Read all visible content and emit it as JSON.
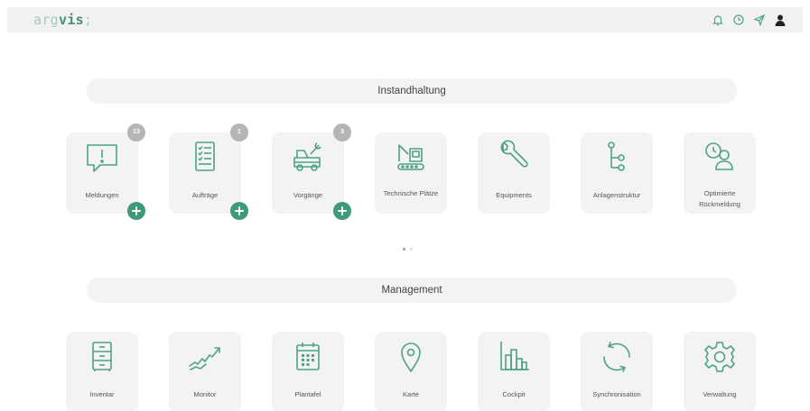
{
  "app": {
    "logo_part1": "arg",
    "logo_part2": "vis",
    "logo_part3": ";"
  },
  "topbar": {
    "icons": [
      "bell-icon",
      "clock-icon",
      "send-icon",
      "user-avatar-icon"
    ]
  },
  "sections": {
    "instandhaltung": {
      "title": "Instandhaltung",
      "tiles": [
        {
          "label": "Meldungen",
          "icon": "message-alert-icon",
          "badge": "13",
          "has_add": true
        },
        {
          "label": "Aufträge",
          "icon": "checklist-icon",
          "badge": "1",
          "has_add": true
        },
        {
          "label": "Vorgänge",
          "icon": "vehicle-wrench-icon",
          "badge": "3",
          "has_add": true
        },
        {
          "label": "Technische Plätze",
          "icon": "technical-place-icon"
        },
        {
          "label": "Equipments",
          "icon": "wrench-icon"
        },
        {
          "label": "Anlagenstruktur",
          "icon": "structure-tree-icon"
        },
        {
          "label": "Optimierte Rückmeldung",
          "icon": "user-clock-icon"
        }
      ],
      "pager": {
        "pages": 2,
        "active": 1
      }
    },
    "management": {
      "title": "Management",
      "tiles": [
        {
          "label": "Inventar",
          "icon": "cabinet-icon"
        },
        {
          "label": "Monitor",
          "icon": "trend-chart-icon"
        },
        {
          "label": "Plantafel",
          "icon": "calendar-icon"
        },
        {
          "label": "Karte",
          "icon": "map-pin-icon"
        },
        {
          "label": "Cockpit",
          "icon": "bar-chart-icon"
        },
        {
          "label": "Synchronisation",
          "icon": "sync-icon"
        },
        {
          "label": "Verwaltung",
          "icon": "gear-icon"
        }
      ]
    }
  },
  "colors": {
    "accent": "#3d9b78",
    "icon_stroke": "#4ea383",
    "tile_bg": "#f3f3f3",
    "badge_bg": "#b5b5b5"
  }
}
